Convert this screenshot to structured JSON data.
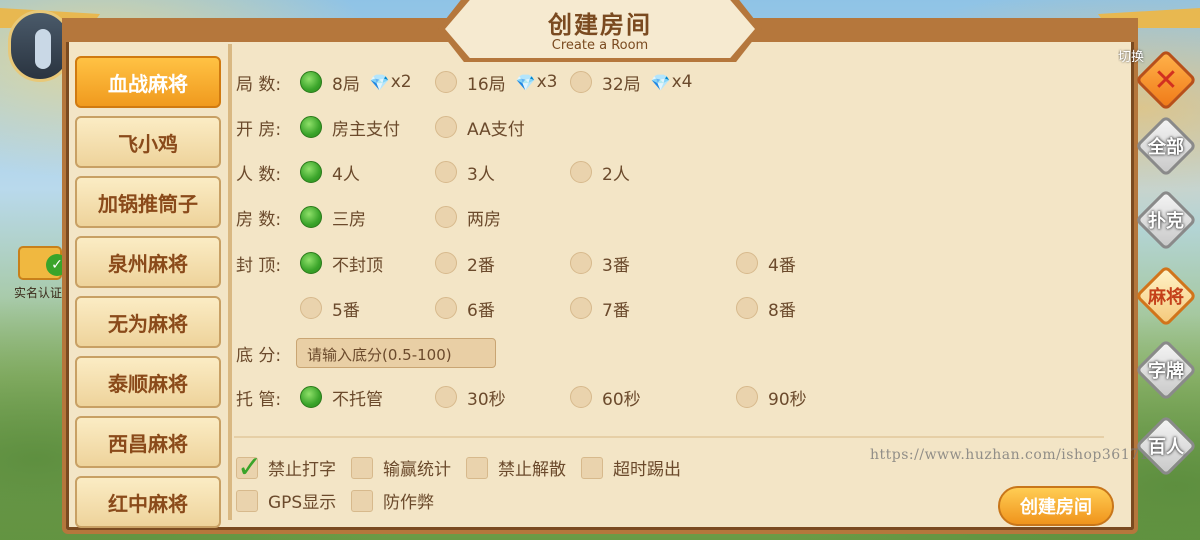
{
  "title": {
    "cn": "创建房间",
    "en": "Create a Room"
  },
  "switch_label": "切换",
  "left_tabs": [
    {
      "label": "血战麻将",
      "active": true
    },
    {
      "label": "飞小鸡",
      "active": false
    },
    {
      "label": "加锅推筒子",
      "active": false
    },
    {
      "label": "泉州麻将",
      "active": false
    },
    {
      "label": "无为麻将",
      "active": false
    },
    {
      "label": "泰顺麻将",
      "active": false
    },
    {
      "label": "西昌麻将",
      "active": false
    },
    {
      "label": "红中麻将",
      "active": false
    }
  ],
  "settings": {
    "rounds": {
      "label": "局 数:",
      "options": [
        {
          "text": "8局",
          "gem": "x2",
          "selected": true
        },
        {
          "text": "16局",
          "gem": "x3",
          "selected": false
        },
        {
          "text": "32局",
          "gem": "x4",
          "selected": false
        }
      ]
    },
    "payment": {
      "label": "开 房:",
      "options": [
        {
          "text": "房主支付",
          "selected": true
        },
        {
          "text": "AA支付",
          "selected": false
        }
      ]
    },
    "players": {
      "label": "人 数:",
      "options": [
        {
          "text": "4人",
          "selected": true
        },
        {
          "text": "3人",
          "selected": false
        },
        {
          "text": "2人",
          "selected": false
        }
      ]
    },
    "rooms": {
      "label": "房 数:",
      "options": [
        {
          "text": "三房",
          "selected": true
        },
        {
          "text": "两房",
          "selected": false
        }
      ]
    },
    "cap": {
      "label": "封 顶:",
      "options": [
        {
          "text": "不封顶",
          "selected": true
        },
        {
          "text": "2番",
          "selected": false
        },
        {
          "text": "3番",
          "selected": false
        },
        {
          "text": "4番",
          "selected": false
        },
        {
          "text": "5番",
          "selected": false
        },
        {
          "text": "6番",
          "selected": false
        },
        {
          "text": "7番",
          "selected": false
        },
        {
          "text": "8番",
          "selected": false
        }
      ]
    },
    "base_score": {
      "label": "底 分:",
      "placeholder": "请输入底分(0.5-100)"
    },
    "auto_play": {
      "label": "托 管:",
      "options": [
        {
          "text": "不托管",
          "selected": true
        },
        {
          "text": "30秒",
          "selected": false
        },
        {
          "text": "60秒",
          "selected": false
        },
        {
          "text": "90秒",
          "selected": false
        }
      ]
    }
  },
  "checkboxes": [
    {
      "text": "禁止打字",
      "checked": true
    },
    {
      "text": "输赢统计",
      "checked": false
    },
    {
      "text": "禁止解散",
      "checked": false
    },
    {
      "text": "超时踢出",
      "checked": false
    },
    {
      "text": "GPS显示",
      "checked": false
    },
    {
      "text": "防作弊",
      "checked": false
    }
  ],
  "create_button": "创建房间",
  "watermark": "https://www.huzhan.com/ishop36171",
  "right_nav": [
    {
      "label": "全部",
      "active": false
    },
    {
      "label": "扑克",
      "active": false
    },
    {
      "label": "麻将",
      "active": true
    },
    {
      "label": "字牌",
      "active": false
    },
    {
      "label": "百人",
      "active": false
    }
  ],
  "verify_label": "实名认证"
}
